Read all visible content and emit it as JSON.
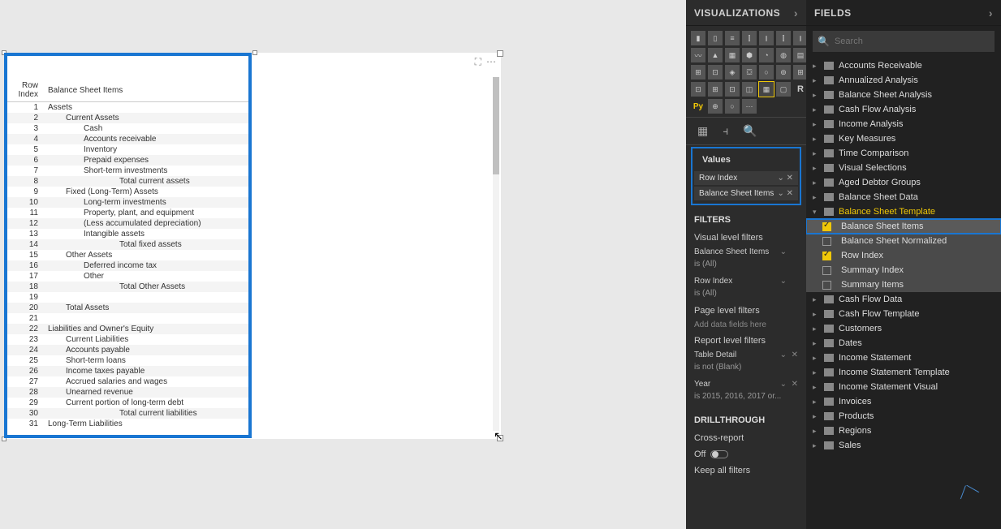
{
  "canvas": {
    "table": {
      "col1": "Row Index",
      "col2": "Balance Sheet Items",
      "rows": [
        {
          "i": "1",
          "t": "Assets",
          "ind": 0
        },
        {
          "i": "2",
          "t": "Current Assets",
          "ind": 1
        },
        {
          "i": "3",
          "t": "Cash",
          "ind": 2
        },
        {
          "i": "4",
          "t": "Accounts receivable",
          "ind": 2
        },
        {
          "i": "5",
          "t": "Inventory",
          "ind": 2
        },
        {
          "i": "6",
          "t": "Prepaid expenses",
          "ind": 2
        },
        {
          "i": "7",
          "t": "Short-term investments",
          "ind": 2
        },
        {
          "i": "8",
          "t": "Total current assets",
          "ind": 4
        },
        {
          "i": "9",
          "t": "Fixed (Long-Term) Assets",
          "ind": 1
        },
        {
          "i": "10",
          "t": "Long-term investments",
          "ind": 2
        },
        {
          "i": "11",
          "t": "Property, plant, and equipment",
          "ind": 2
        },
        {
          "i": "12",
          "t": "(Less accumulated depreciation)",
          "ind": 2
        },
        {
          "i": "13",
          "t": "Intangible assets",
          "ind": 2
        },
        {
          "i": "14",
          "t": "Total fixed assets",
          "ind": 4
        },
        {
          "i": "15",
          "t": "Other Assets",
          "ind": 1
        },
        {
          "i": "16",
          "t": "Deferred income tax",
          "ind": 2
        },
        {
          "i": "17",
          "t": "Other",
          "ind": 2
        },
        {
          "i": "18",
          "t": "Total Other Assets",
          "ind": 4
        },
        {
          "i": "19",
          "t": "",
          "ind": 0
        },
        {
          "i": "20",
          "t": "Total Assets",
          "ind": 1
        },
        {
          "i": "21",
          "t": "",
          "ind": 0
        },
        {
          "i": "22",
          "t": "Liabilities and Owner's Equity",
          "ind": 0
        },
        {
          "i": "23",
          "t": "Current Liabilities",
          "ind": 1
        },
        {
          "i": "24",
          "t": "Accounts payable",
          "ind": 1
        },
        {
          "i": "25",
          "t": "Short-term loans",
          "ind": 1
        },
        {
          "i": "26",
          "t": "Income taxes payable",
          "ind": 1
        },
        {
          "i": "27",
          "t": "Accrued salaries and wages",
          "ind": 1
        },
        {
          "i": "28",
          "t": "Unearned revenue",
          "ind": 1
        },
        {
          "i": "29",
          "t": "Current portion of long-term debt",
          "ind": 1
        },
        {
          "i": "30",
          "t": "Total current liabilities",
          "ind": 4
        },
        {
          "i": "31",
          "t": "Long-Term Liabilities",
          "ind": 0
        }
      ]
    }
  },
  "viz": {
    "title": "VISUALIZATIONS",
    "values_label": "Values",
    "wells": [
      "Row Index",
      "Balance Sheet Items"
    ],
    "filters_label": "FILTERS",
    "visual_filters_label": "Visual level filters",
    "vf1": "Balance Sheet Items",
    "vf1v": "is (All)",
    "vf2": "Row Index",
    "vf2v": "is (All)",
    "page_filters_label": "Page level filters",
    "add_placeholder": "Add data fields here",
    "report_filters_label": "Report level filters",
    "rf1": "Table Detail",
    "rf1v": "is not (Blank)",
    "rf2": "Year",
    "rf2v": "is 2015, 2016, 2017 or...",
    "drill_label": "DRILLTHROUGH",
    "cross_label": "Cross-report",
    "off_label": "Off",
    "keep_label": "Keep all filters"
  },
  "fields": {
    "title": "FIELDS",
    "search_placeholder": "Search",
    "tables": [
      "Accounts Receivable",
      "Annualized Analysis",
      "Balance Sheet Analysis",
      "Cash Flow Analysis",
      "Income Analysis",
      "Key Measures",
      "Time Comparison",
      "Visual Selections",
      "Aged Debtor Groups",
      "Balance Sheet Data"
    ],
    "expanded_table": "Balance Sheet Template",
    "expanded_fields": [
      {
        "name": "Balance Sheet Items",
        "checked": true,
        "hl": true
      },
      {
        "name": "Balance Sheet Normalized",
        "checked": false,
        "hl": false
      },
      {
        "name": "Row Index",
        "checked": true,
        "hl": false
      },
      {
        "name": "Summary Index",
        "checked": false,
        "hl": false
      },
      {
        "name": "Summary Items",
        "checked": false,
        "hl": false
      }
    ],
    "tables_after": [
      "Cash Flow Data",
      "Cash Flow Template",
      "Customers",
      "Dates",
      "Income Statement",
      "Income Statement Template",
      "Income Statement Visual",
      "Invoices",
      "Products",
      "Regions",
      "Sales"
    ]
  }
}
